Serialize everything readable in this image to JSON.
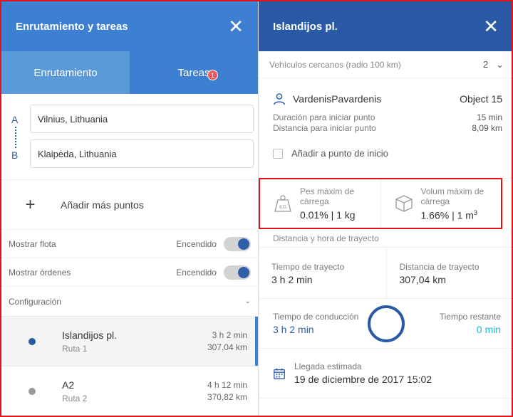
{
  "left_panel": {
    "title": "Enrutamiento y tareas",
    "close_glyph": "✕",
    "tabs": [
      {
        "label": "Enrutamiento"
      },
      {
        "label": "Tareas",
        "badge": "1"
      }
    ],
    "point_a_label": "A",
    "point_b_label": "B",
    "point_a_value": "Vilnius, Lithuania",
    "point_b_value": "Klaipėda, Lithuania",
    "add_points_glyph": "+",
    "add_points_label": "Añadir más puntos",
    "toggles": [
      {
        "label": "Mostrar flota",
        "state": "Encendido"
      },
      {
        "label": "Mostrar órdenes",
        "state": "Encendido"
      }
    ],
    "config_label": "Configuración",
    "config_chevron": "⌄",
    "routes": [
      {
        "name": "Islandijos pl.",
        "sub": "Ruta 1",
        "time": "3 h 2 min",
        "distance": "307,04 km",
        "dot_color": "#2a5aa6"
      },
      {
        "name": "A2",
        "sub": "Ruta 2",
        "time": "4 h 12 min",
        "distance": "370,82 km",
        "dot_color": "#999999"
      }
    ]
  },
  "right_panel": {
    "title": "Islandijos pl.",
    "close_glyph": "✕",
    "nearby_label": "Vehículos cercanos (radio 100 km)",
    "nearby_count": "2",
    "nearby_chevron": "⌄",
    "vehicle": {
      "name": "VardenisPavardenis",
      "object": "Object 15",
      "stats": [
        {
          "label": "Duración para iniciar punto",
          "value": "15 min"
        },
        {
          "label": "Distancia para iniciar punto",
          "value": "8,09 km"
        }
      ],
      "checkbox_label": "Añadir a punto de inicio"
    },
    "capacity": {
      "weight_label": "Pes màxim de càrrega",
      "weight_icon_text": "KG",
      "weight_value": "0.01% | 1 kg",
      "volume_label": "Volum màxim de càrrega",
      "volume_value": "1.66% | 1 m",
      "volume_unit_exp": "3"
    },
    "distance_title": "Distancia y hora de trayecto",
    "trip_time_label": "Tiempo de trayecto",
    "trip_time_value": "3 h 2 min",
    "trip_distance_label": "Distancia de trayecto",
    "trip_distance_value": "307,04 km",
    "drive_label": "Tiempo de conducción",
    "drive_value": "3 h 2 min",
    "remaining_label": "Tiempo restante",
    "remaining_value": "0 min",
    "arrival_label": "Llegada estimada",
    "arrival_value": "19 de diciembre de 2017 15:02"
  }
}
